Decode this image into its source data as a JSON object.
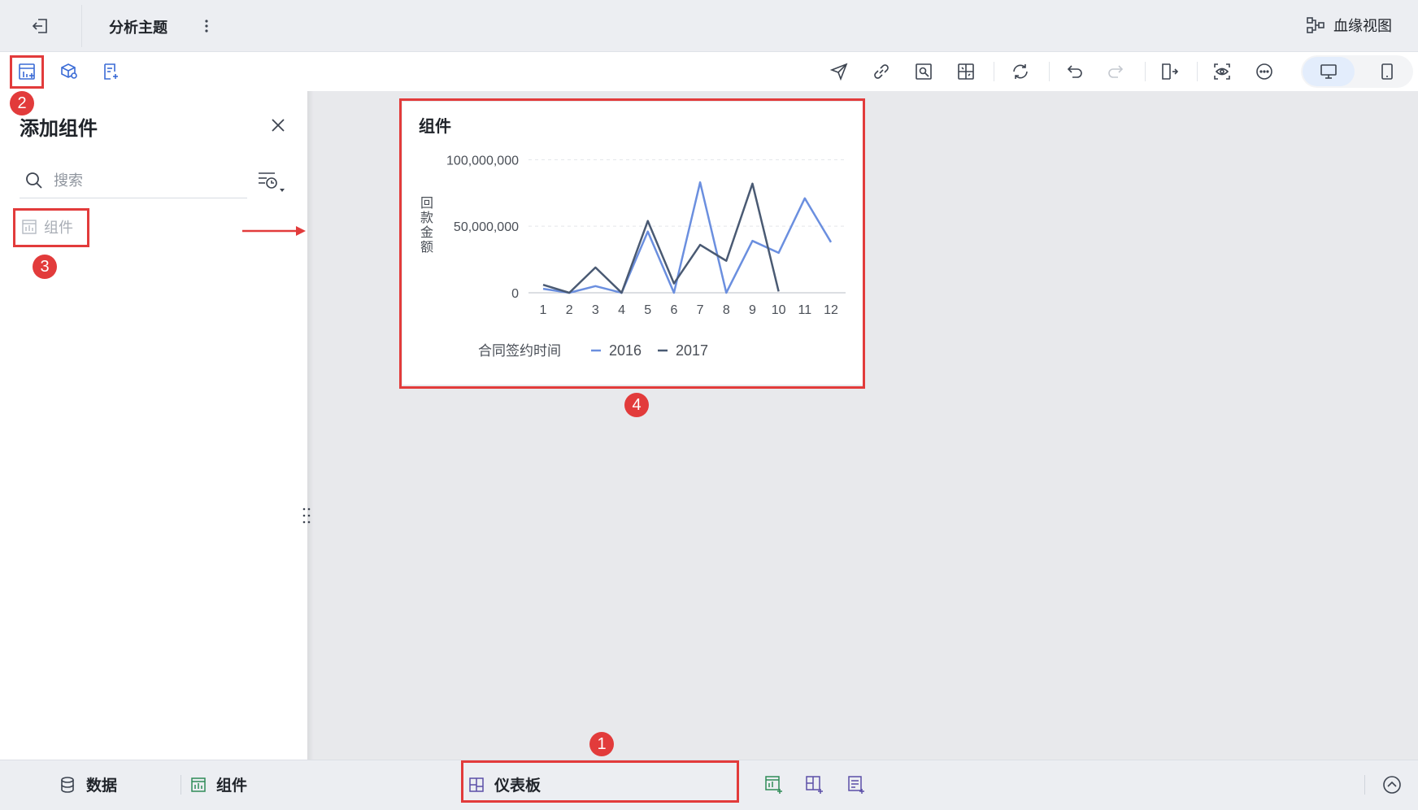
{
  "header": {
    "title": "分析主题",
    "lineage_label": "血缘视图"
  },
  "toolbar": {
    "left_icons": [
      "add-component-icon",
      "add-dataset-icon",
      "add-text-icon"
    ],
    "right_icons": [
      "send-icon",
      "link-icon",
      "export-image-icon",
      "layout-grid-icon",
      "refresh-icon",
      "undo-icon",
      "redo-icon",
      "exit-edit-icon",
      "preview-icon",
      "more-icon",
      "desktop-icon",
      "mobile-icon"
    ]
  },
  "panel": {
    "title": "添加组件",
    "search_placeholder": "搜索",
    "items": [
      {
        "label": "组件",
        "icon": "chart-component-icon"
      }
    ]
  },
  "annotations": [
    "1",
    "2",
    "3",
    "4"
  ],
  "widget": {
    "title": "组件"
  },
  "chart_data": {
    "type": "line",
    "title": "组件",
    "xlabel": "",
    "ylabel": "回款金额",
    "x": [
      "1",
      "2",
      "3",
      "4",
      "5",
      "6",
      "7",
      "8",
      "9",
      "10",
      "11",
      "12"
    ],
    "y_ticks": [
      "100,000,000",
      "50,000,000",
      "0"
    ],
    "ylim": [
      0,
      110000000
    ],
    "grid": true,
    "legend_title": "合同签约时间",
    "legend_position": "bottom",
    "series": [
      {
        "name": "2016",
        "color": "#6b8fdf",
        "values": [
          3000000,
          0,
          5000000,
          0,
          46000000,
          0,
          83000000,
          0,
          39000000,
          30000000,
          71000000,
          38000000
        ]
      },
      {
        "name": "2017",
        "color": "#4a5a73",
        "values": [
          6000000,
          0,
          19000000,
          0,
          54000000,
          7000000,
          36000000,
          24000000,
          82000000,
          1000000
        ]
      }
    ]
  },
  "bottom": {
    "data_label": "数据",
    "component_label": "组件",
    "dashboard_label": "仪表板"
  }
}
